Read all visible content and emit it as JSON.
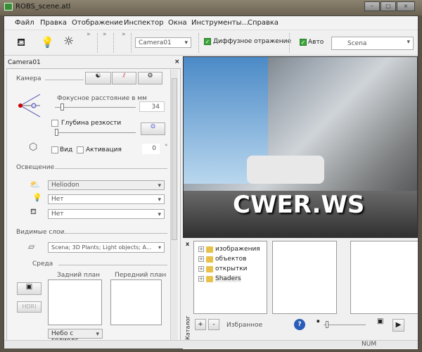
{
  "window": {
    "title": "ROBS_scene.atl",
    "minimize": "–",
    "maximize": "□",
    "close": "×"
  },
  "menu": [
    "Файл",
    "Правка",
    "Отображение",
    "Инспектор",
    "Окна",
    "Инструменты...",
    "Справка"
  ],
  "toolbar": {
    "camera_select": "Camera01",
    "diffuse_label": "Диффузное отражение",
    "diffuse_checked": true,
    "auto_label": "Авто",
    "auto_checked": true,
    "scene_select": "Scena",
    "chevron": "»"
  },
  "inspector": {
    "title": "Camera01",
    "close": "×",
    "camera_section": "Камера",
    "focal_label": "Фокусное расстояние в мм",
    "focal_value": "34",
    "dof_label": "Глубина резкости",
    "view_label": "Вид",
    "activation_label": "Активация",
    "angle_value": "0",
    "degree": "°",
    "lighting_section": "Освещение",
    "sun_select": "Heliodon",
    "light_select": "Нет",
    "ambient_select": "Нет",
    "layers_section": "Видимые слои",
    "layers_select": "Scena; 3D Plants; Light objects; A...",
    "env_section": "Среда",
    "background_label": "Задний план",
    "foreground_label": "Передний план",
    "hdri_label": "HDRI",
    "sky_select": "Небо с гелиодс"
  },
  "viewport": {
    "watermark": "CWER.WS"
  },
  "catalog": {
    "tab": "Каталог",
    "close": "x",
    "items": [
      "изображения",
      "объектов",
      "открытки",
      "Shaders"
    ],
    "add": "+",
    "remove": "-",
    "favorites": "Избранное",
    "help": "?"
  },
  "status": {
    "num": "NUM"
  }
}
